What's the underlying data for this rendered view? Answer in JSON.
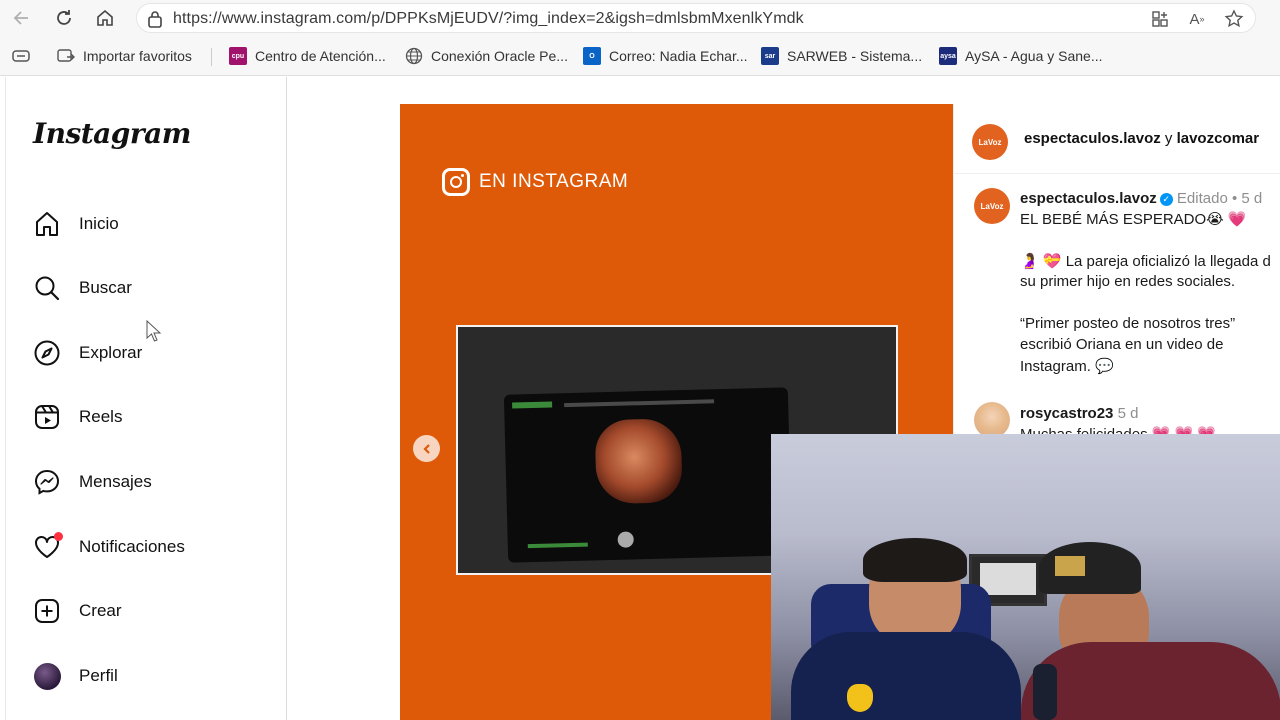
{
  "browser": {
    "url": "https://www.instagram.com/p/DPPKsMjEUDV/?img_index=2&igsh=dmlsbmMxenlkYmdk",
    "nav_icons": [
      "back-icon",
      "refresh-icon",
      "home-icon"
    ],
    "right_icons": [
      "split-screen-icon",
      "read-aloud-icon",
      "favorite-star-icon"
    ],
    "favorites": [
      {
        "label": "Importar favoritos",
        "icon": "import-icon"
      },
      {
        "label": "Centro de Atención...",
        "icon": "cpu-favicon",
        "color": "#a0126b",
        "badge": "cpu"
      },
      {
        "label": "Conexión Oracle Pe...",
        "icon": "globe-icon"
      },
      {
        "label": "Correo: Nadia Echar...",
        "icon": "outlook-icon",
        "color": "#0a64c8"
      },
      {
        "label": "SARWEB - Sistema...",
        "icon": "sar-favicon",
        "color": "#1a3c8a",
        "badge": "sar"
      },
      {
        "label": "AySA - Agua y Sane...",
        "icon": "aysa-favicon",
        "color": "#1d2c7a",
        "badge": "aysa"
      }
    ]
  },
  "sidebar": {
    "logo": "Instagram",
    "items": [
      {
        "label": "Inicio",
        "icon": "home-icon"
      },
      {
        "label": "Buscar",
        "icon": "search-icon"
      },
      {
        "label": "Explorar",
        "icon": "compass-icon"
      },
      {
        "label": "Reels",
        "icon": "reels-icon"
      },
      {
        "label": "Mensajes",
        "icon": "messenger-icon"
      },
      {
        "label": "Notificaciones",
        "icon": "heart-icon"
      },
      {
        "label": "Crear",
        "icon": "plus-square-icon"
      },
      {
        "label": "Perfil",
        "icon": "profile-avatar"
      }
    ]
  },
  "post": {
    "badge_text": "EN INSTAGRAM",
    "background_color": "#de5a09",
    "header": {
      "user1": "espectaculos.lavoz",
      "joiner": "y",
      "user2": "lavozcomar",
      "avatar_text": "LaVoz"
    },
    "caption": {
      "username": "espectaculos.lavoz",
      "edited": "Editado",
      "dot": "•",
      "time": "5 d",
      "line1": "EL BEBÉ MÁS ESPERADO😭 💗",
      "line2": "🤰 💝 La pareja oficializó la llegada d",
      "line3": "su primer hijo en redes sociales.",
      "line4": "“Primer posteo de nosotros tres”",
      "line5": "escribió Oriana en un video de",
      "line6": "Instagram. 💬"
    },
    "comment": {
      "username": "rosycastro23",
      "time": "5 d",
      "text": "Muchas felicidades 💗 💗 💗"
    }
  }
}
